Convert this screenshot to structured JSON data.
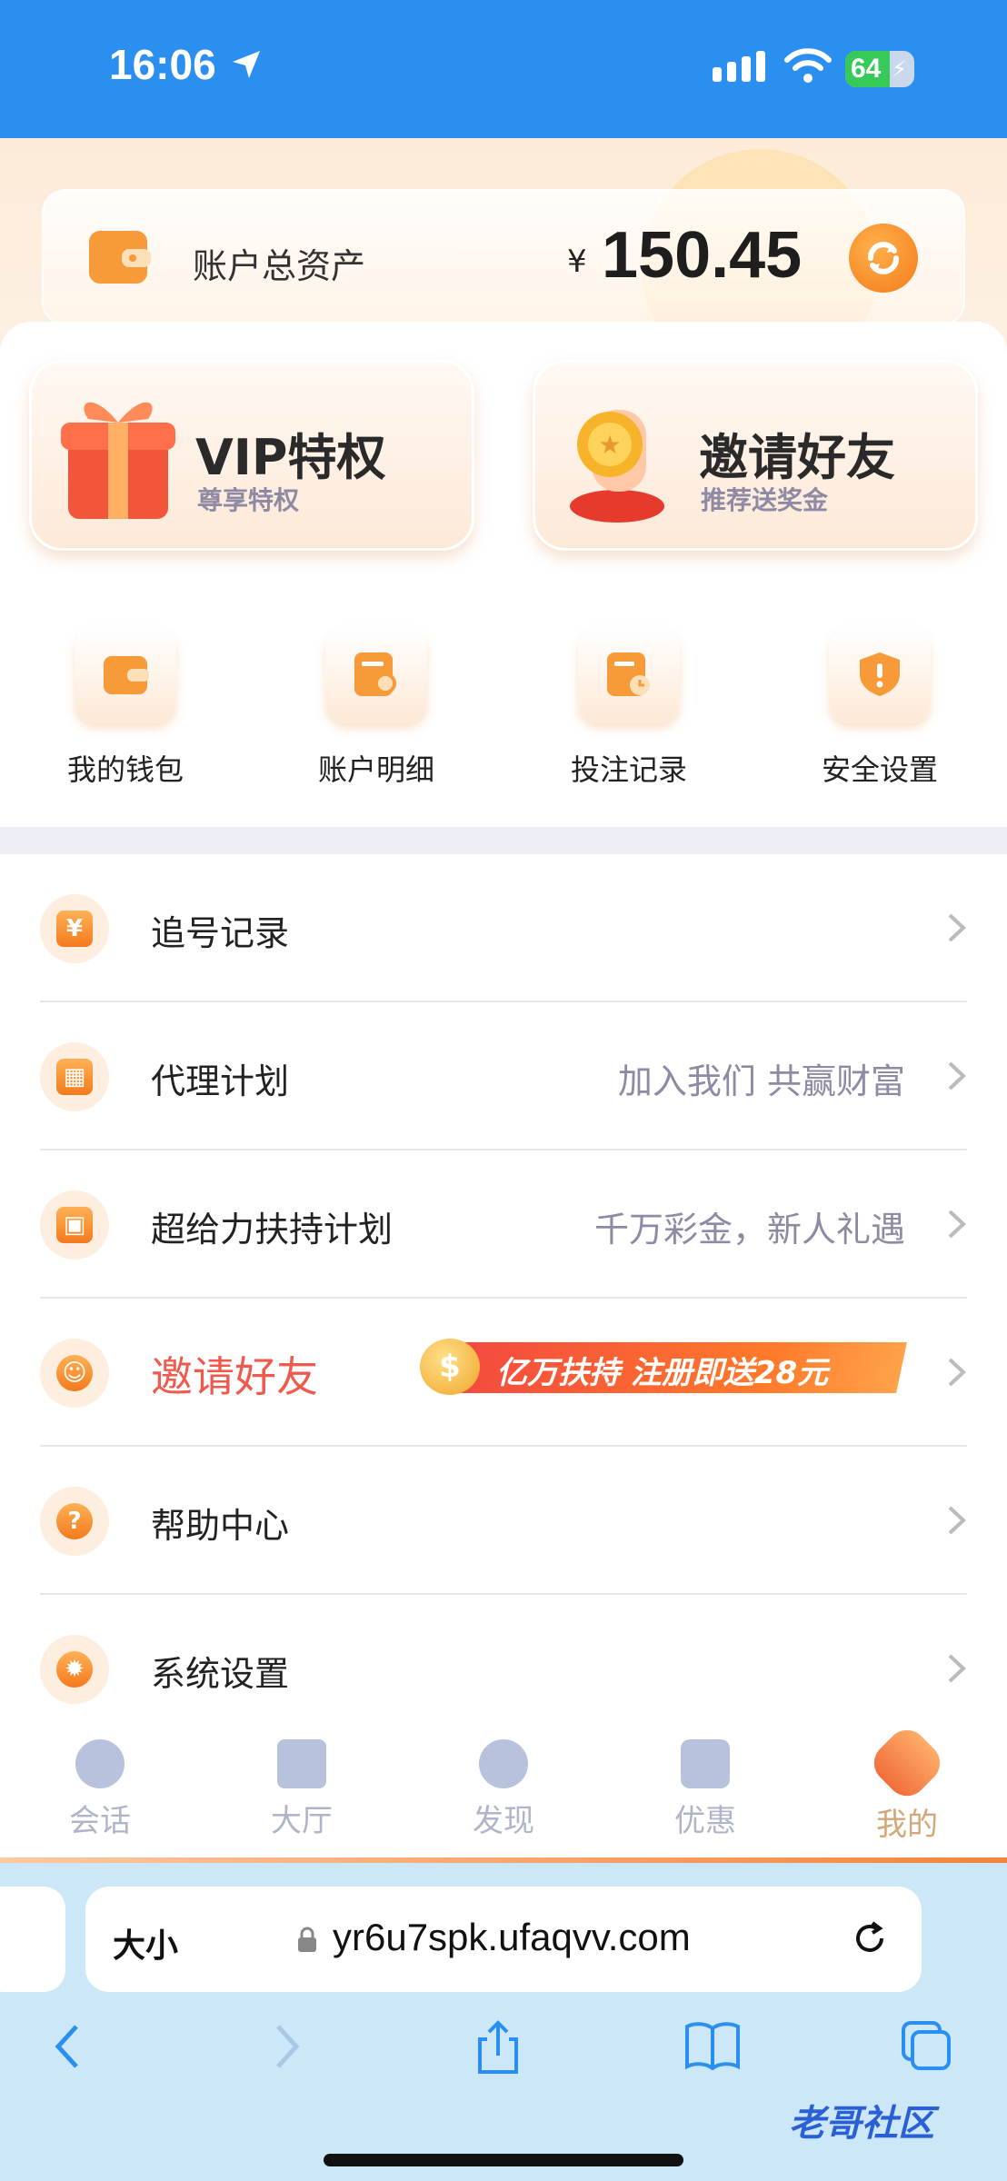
{
  "status_bar": {
    "time": "16:06",
    "battery": "64",
    "battery_level": 0.64
  },
  "account": {
    "label": "账户总资产",
    "currency": "¥",
    "amount": "150.45"
  },
  "promos": [
    {
      "title": "VIP特权",
      "subtitle": "尊享特权",
      "icon": "gift-box-icon"
    },
    {
      "title": "邀请好友",
      "subtitle": "推荐送奖金",
      "icon": "coin-hand-icon"
    }
  ],
  "quick_actions": [
    {
      "label": "我的钱包",
      "icon": "wallet-icon"
    },
    {
      "label": "账户明细",
      "icon": "search-document-icon"
    },
    {
      "label": "投注记录",
      "icon": "record-clock-icon"
    },
    {
      "label": "安全设置",
      "icon": "shield-icon"
    }
  ],
  "menu": [
    {
      "label": "追号记录",
      "hint": "",
      "icon": "yen-clipboard-icon"
    },
    {
      "label": "代理计划",
      "hint": "加入我们 共赢财富",
      "icon": "qr-code-icon"
    },
    {
      "label": "超给力扶持计划",
      "hint": "千万彩金，新人礼遇",
      "icon": "gift-icon"
    },
    {
      "label": "邀请好友",
      "hint": "",
      "banner": "亿万扶持 注册即送28元",
      "icon": "users-icon"
    },
    {
      "label": "帮助中心",
      "hint": "",
      "icon": "help-icon"
    },
    {
      "label": "系统设置",
      "hint": "",
      "icon": "gear-icon"
    }
  ],
  "tabs": [
    {
      "label": "会话",
      "icon": "chat-icon",
      "active": false
    },
    {
      "label": "大厅",
      "icon": "bank-icon",
      "active": false
    },
    {
      "label": "发现",
      "icon": "compass-icon",
      "active": false
    },
    {
      "label": "优惠",
      "icon": "yen-ticket-icon",
      "active": false
    },
    {
      "label": "我的",
      "icon": "user-icon",
      "active": true
    }
  ],
  "browser": {
    "text_size": "大小",
    "url": "yr6u7spk.ufaqvv.com"
  },
  "watermark": "老哥社区",
  "colors": {
    "accent": "#f47a1d",
    "status_bar": "#2b8ff0",
    "invite_red": "#f05a4e"
  }
}
